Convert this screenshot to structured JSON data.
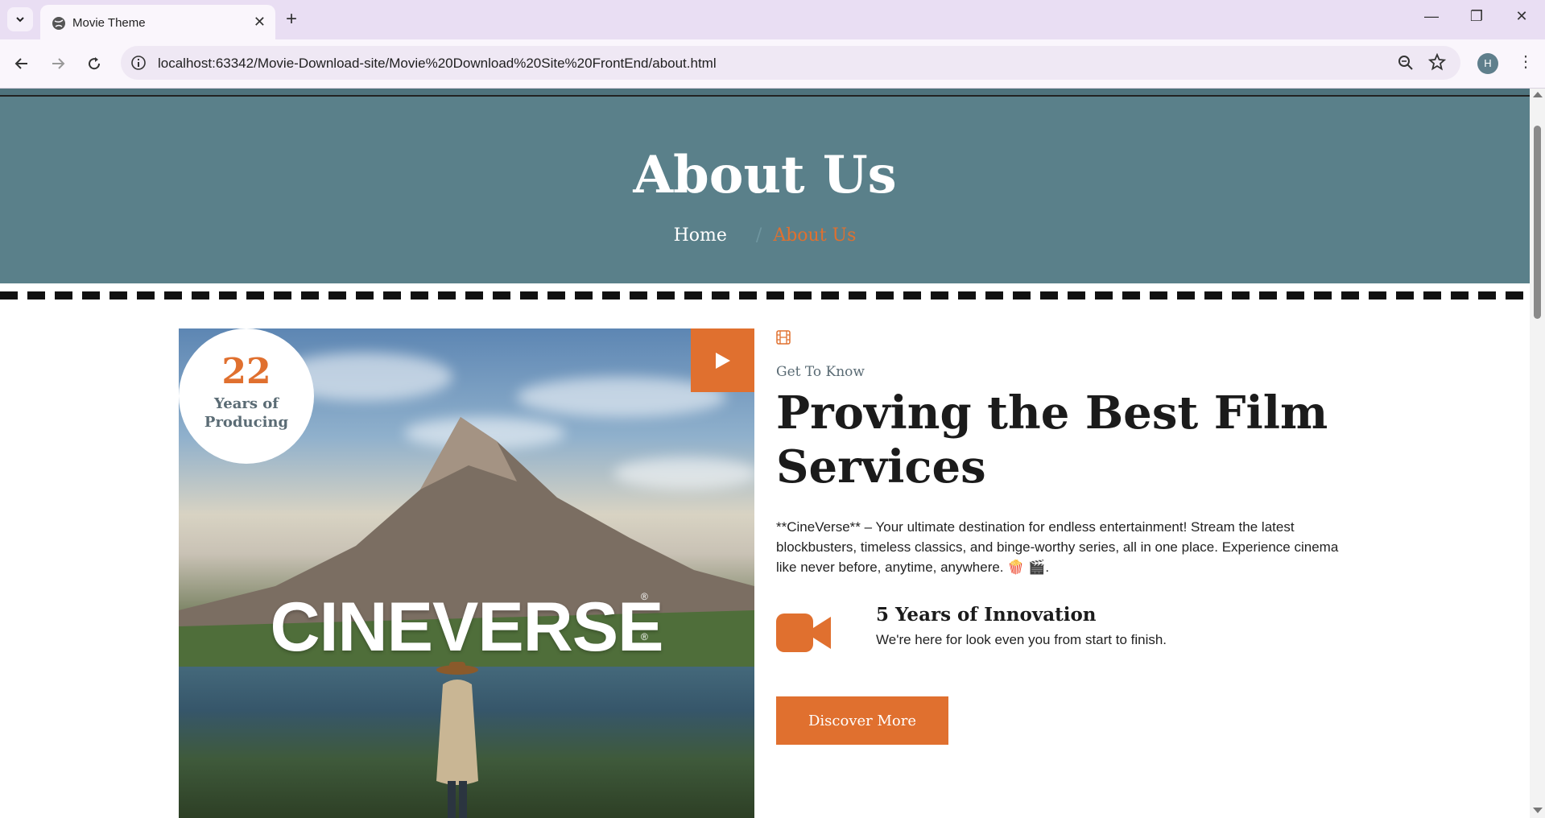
{
  "browser": {
    "tab_title": "Movie Theme",
    "url": "localhost:63342/Movie-Download-site/Movie%20Download%20Site%20FrontEnd/about.html",
    "profile_initial": "H",
    "icons": [
      "tab-list-icon",
      "globe-icon",
      "close-icon",
      "plus-icon",
      "minimize-icon",
      "restore-icon",
      "close-window-icon",
      "back-icon",
      "forward-icon",
      "reload-icon",
      "info-icon",
      "zoom-icon",
      "star-icon",
      "menu-icon"
    ]
  },
  "hero": {
    "title": "About Us",
    "breadcrumb_home": "Home",
    "breadcrumb_sep": "/",
    "breadcrumb_current": "About Us"
  },
  "poster": {
    "brand": "CINEVERSE",
    "registered": "®",
    "badge_number": "22",
    "badge_line1": "Years of",
    "badge_line2": "Producing"
  },
  "about": {
    "kicker": "Get To Know",
    "heading": "Proving the Best Film Services",
    "description": "**CineVerse** – Your ultimate destination for endless entertainment! Stream the latest blockbusters, timeless classics, and binge-worthy series, all in one place. Experience cinema like never before, anytime, anywhere. 🍿 🎬.",
    "feature_title": "5 Years of Innovation",
    "feature_text": "We're here for look even you from start to finish.",
    "button_label": "Discover More"
  },
  "colors": {
    "hero_bg": "#5a808a",
    "accent": "#e0702f",
    "tab_bar": "#e9def3"
  }
}
